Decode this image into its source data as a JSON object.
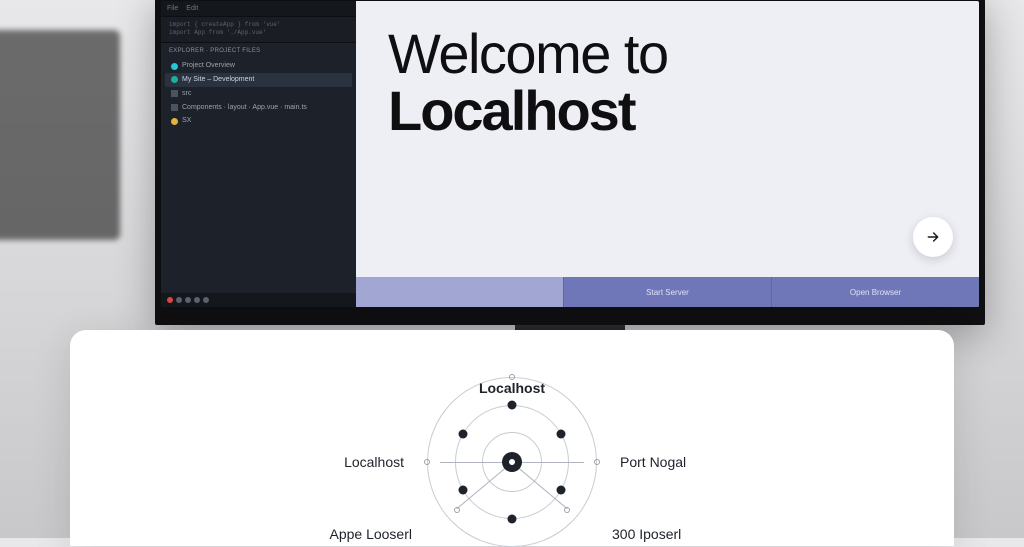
{
  "ide": {
    "tabs": [
      "File",
      "Edit"
    ],
    "code_lines": [
      "import { createApp } from 'vue'",
      "import App from './App.vue'"
    ],
    "section_title": "EXPLORER · PROJECT FILES",
    "tree": [
      {
        "label": "Project Overview",
        "dot": "cyan",
        "selected": false
      },
      {
        "label": "My Site – Development",
        "dot": "teal",
        "selected": true
      },
      {
        "label": "src",
        "dot": "gray",
        "selected": false
      },
      {
        "label": "Components · layout · App.vue · main.ts",
        "dot": "gray",
        "selected": false
      },
      {
        "label": "SX",
        "dot": "yellow",
        "selected": false
      }
    ]
  },
  "welcome": {
    "line1": "Welcome to",
    "line2": "Localhost",
    "tabs": [
      {
        "label": "",
        "active": true
      },
      {
        "label": "Start Server",
        "active": false
      },
      {
        "label": "Open Browser",
        "active": false
      }
    ]
  },
  "diagram": {
    "labels": {
      "top": "Localhost",
      "left": "Localhost",
      "right": "Port Nogal",
      "bottom_left": "Appe Looserl",
      "bottom_right": "300 Iposerl"
    }
  }
}
